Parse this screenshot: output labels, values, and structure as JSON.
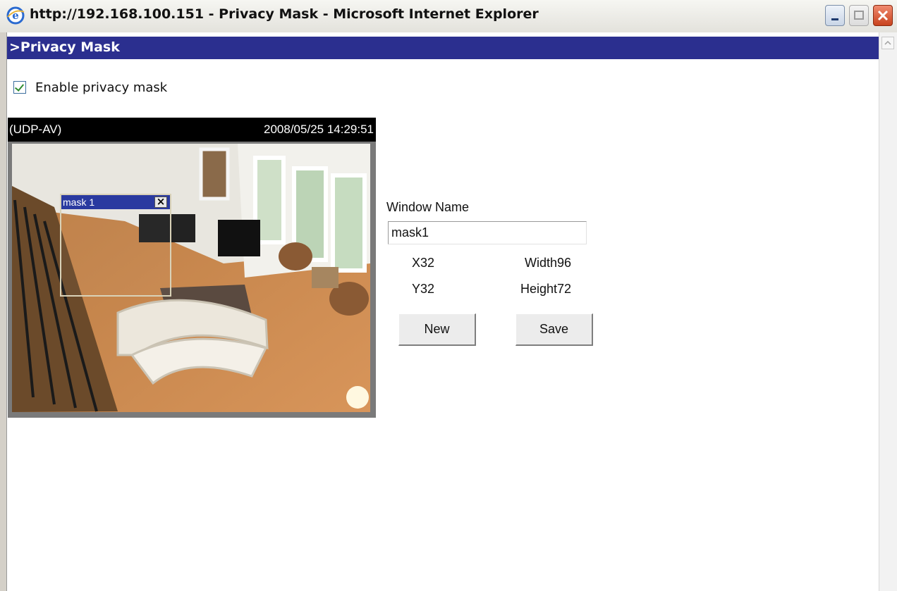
{
  "window": {
    "title": "http://192.168.100.151 - Privacy Mask - Microsoft Internet Explorer",
    "icon": "ie-icon"
  },
  "page": {
    "header": ">Privacy Mask",
    "enable_checkbox": {
      "label": "Enable privacy mask",
      "checked": true
    }
  },
  "video": {
    "stream_label": "(UDP-AV)",
    "timestamp": "2008/05/25 14:29:51",
    "mask": {
      "title": "mask 1",
      "close_icon": "close-icon"
    }
  },
  "form": {
    "window_name_label": "Window Name",
    "window_name_value": "mask1",
    "x_label": "X32",
    "y_label": "Y32",
    "width_label": "Width96",
    "height_label": "Height72",
    "new_button": "New",
    "save_button": "Save"
  }
}
